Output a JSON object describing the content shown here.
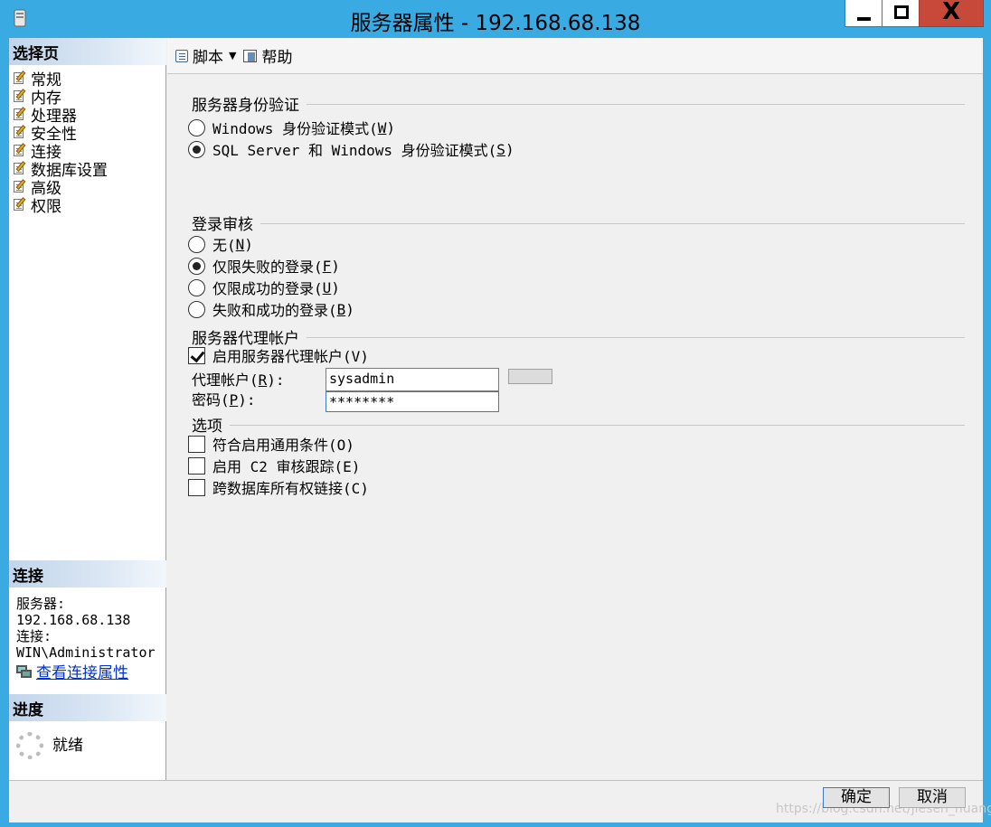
{
  "window": {
    "title": "服务器属性 - 192.168.68.138",
    "close_glyph": "X"
  },
  "left": {
    "select_page_header": "选择页",
    "pages": [
      "常规",
      "内存",
      "处理器",
      "安全性",
      "连接",
      "数据库设置",
      "高级",
      "权限"
    ],
    "selected_page": "安全性",
    "connection_header": "连接",
    "server_label": "服务器:",
    "server_value": "192.168.68.138",
    "connection_label": "连接:",
    "connection_value": "WIN\\Administrator",
    "view_connection_link": "查看连接属性",
    "progress_header": "进度",
    "progress_status": "就绪"
  },
  "toolbar": {
    "script_label": "脚本",
    "help_label": "帮助"
  },
  "auth": {
    "title": "服务器身份验证",
    "windows_mode": {
      "text": "Windows 身份验证模式(",
      "key": "W",
      "tail": ")"
    },
    "mixed_mode": {
      "text": "SQL Server 和 Windows 身份验证模式(",
      "key": "S",
      "tail": ")"
    },
    "selected": "mixed"
  },
  "audit": {
    "title": "登录审核",
    "none": {
      "text": "无(",
      "key": "N",
      "tail": ")"
    },
    "failed_only": {
      "text": "仅限失败的登录(",
      "key": "F",
      "tail": ")"
    },
    "success_only": {
      "text": "仅限成功的登录(",
      "key": "U",
      "tail": ")"
    },
    "both": {
      "text": "失败和成功的登录(",
      "key": "B",
      "tail": ")"
    },
    "selected": "failed_only"
  },
  "proxy": {
    "title": "服务器代理帐户",
    "enable_label": "启用服务器代理帐户(V)",
    "enabled": true,
    "account_label": {
      "text": "代理帐户(",
      "key": "R",
      "tail": "):"
    },
    "account_value": "sysadmin",
    "password_label": {
      "text": "密码(",
      "key": "P",
      "tail": "):"
    },
    "password_value": "********"
  },
  "options": {
    "title": "选项",
    "common_criteria": "符合启用通用条件(O)",
    "c2_audit": "启用 C2 审核跟踪(E)",
    "cross_db_chaining": "跨数据库所有权链接(C)"
  },
  "buttons": {
    "ok": "确定",
    "cancel": "取消"
  },
  "watermark": "https://blog.csdn.net/jiesen_huang"
}
